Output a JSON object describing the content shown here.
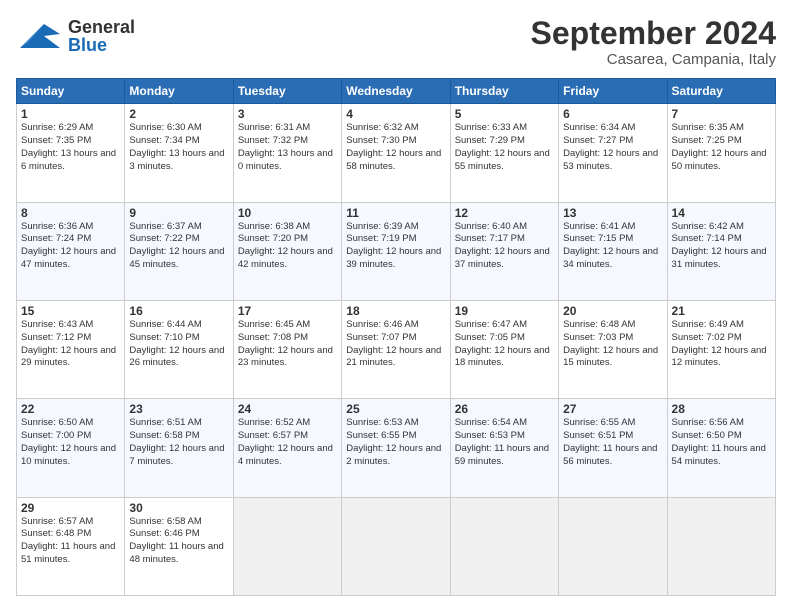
{
  "header": {
    "logo_general": "General",
    "logo_blue": "Blue",
    "month_title": "September 2024",
    "location": "Casarea, Campania, Italy"
  },
  "columns": [
    "Sunday",
    "Monday",
    "Tuesday",
    "Wednesday",
    "Thursday",
    "Friday",
    "Saturday"
  ],
  "weeks": [
    [
      {
        "day": "1",
        "sunrise": "6:29 AM",
        "sunset": "7:35 PM",
        "daylight": "13 hours and 6 minutes."
      },
      {
        "day": "2",
        "sunrise": "6:30 AM",
        "sunset": "7:34 PM",
        "daylight": "13 hours and 3 minutes."
      },
      {
        "day": "3",
        "sunrise": "6:31 AM",
        "sunset": "7:32 PM",
        "daylight": "13 hours and 0 minutes."
      },
      {
        "day": "4",
        "sunrise": "6:32 AM",
        "sunset": "7:30 PM",
        "daylight": "12 hours and 58 minutes."
      },
      {
        "day": "5",
        "sunrise": "6:33 AM",
        "sunset": "7:29 PM",
        "daylight": "12 hours and 55 minutes."
      },
      {
        "day": "6",
        "sunrise": "6:34 AM",
        "sunset": "7:27 PM",
        "daylight": "12 hours and 53 minutes."
      },
      {
        "day": "7",
        "sunrise": "6:35 AM",
        "sunset": "7:25 PM",
        "daylight": "12 hours and 50 minutes."
      }
    ],
    [
      {
        "day": "8",
        "sunrise": "6:36 AM",
        "sunset": "7:24 PM",
        "daylight": "12 hours and 47 minutes."
      },
      {
        "day": "9",
        "sunrise": "6:37 AM",
        "sunset": "7:22 PM",
        "daylight": "12 hours and 45 minutes."
      },
      {
        "day": "10",
        "sunrise": "6:38 AM",
        "sunset": "7:20 PM",
        "daylight": "12 hours and 42 minutes."
      },
      {
        "day": "11",
        "sunrise": "6:39 AM",
        "sunset": "7:19 PM",
        "daylight": "12 hours and 39 minutes."
      },
      {
        "day": "12",
        "sunrise": "6:40 AM",
        "sunset": "7:17 PM",
        "daylight": "12 hours and 37 minutes."
      },
      {
        "day": "13",
        "sunrise": "6:41 AM",
        "sunset": "7:15 PM",
        "daylight": "12 hours and 34 minutes."
      },
      {
        "day": "14",
        "sunrise": "6:42 AM",
        "sunset": "7:14 PM",
        "daylight": "12 hours and 31 minutes."
      }
    ],
    [
      {
        "day": "15",
        "sunrise": "6:43 AM",
        "sunset": "7:12 PM",
        "daylight": "12 hours and 29 minutes."
      },
      {
        "day": "16",
        "sunrise": "6:44 AM",
        "sunset": "7:10 PM",
        "daylight": "12 hours and 26 minutes."
      },
      {
        "day": "17",
        "sunrise": "6:45 AM",
        "sunset": "7:08 PM",
        "daylight": "12 hours and 23 minutes."
      },
      {
        "day": "18",
        "sunrise": "6:46 AM",
        "sunset": "7:07 PM",
        "daylight": "12 hours and 21 minutes."
      },
      {
        "day": "19",
        "sunrise": "6:47 AM",
        "sunset": "7:05 PM",
        "daylight": "12 hours and 18 minutes."
      },
      {
        "day": "20",
        "sunrise": "6:48 AM",
        "sunset": "7:03 PM",
        "daylight": "12 hours and 15 minutes."
      },
      {
        "day": "21",
        "sunrise": "6:49 AM",
        "sunset": "7:02 PM",
        "daylight": "12 hours and 12 minutes."
      }
    ],
    [
      {
        "day": "22",
        "sunrise": "6:50 AM",
        "sunset": "7:00 PM",
        "daylight": "12 hours and 10 minutes."
      },
      {
        "day": "23",
        "sunrise": "6:51 AM",
        "sunset": "6:58 PM",
        "daylight": "12 hours and 7 minutes."
      },
      {
        "day": "24",
        "sunrise": "6:52 AM",
        "sunset": "6:57 PM",
        "daylight": "12 hours and 4 minutes."
      },
      {
        "day": "25",
        "sunrise": "6:53 AM",
        "sunset": "6:55 PM",
        "daylight": "12 hours and 2 minutes."
      },
      {
        "day": "26",
        "sunrise": "6:54 AM",
        "sunset": "6:53 PM",
        "daylight": "11 hours and 59 minutes."
      },
      {
        "day": "27",
        "sunrise": "6:55 AM",
        "sunset": "6:51 PM",
        "daylight": "11 hours and 56 minutes."
      },
      {
        "day": "28",
        "sunrise": "6:56 AM",
        "sunset": "6:50 PM",
        "daylight": "11 hours and 54 minutes."
      }
    ],
    [
      {
        "day": "29",
        "sunrise": "6:57 AM",
        "sunset": "6:48 PM",
        "daylight": "11 hours and 51 minutes."
      },
      {
        "day": "30",
        "sunrise": "6:58 AM",
        "sunset": "6:46 PM",
        "daylight": "11 hours and 48 minutes."
      },
      null,
      null,
      null,
      null,
      null
    ]
  ]
}
